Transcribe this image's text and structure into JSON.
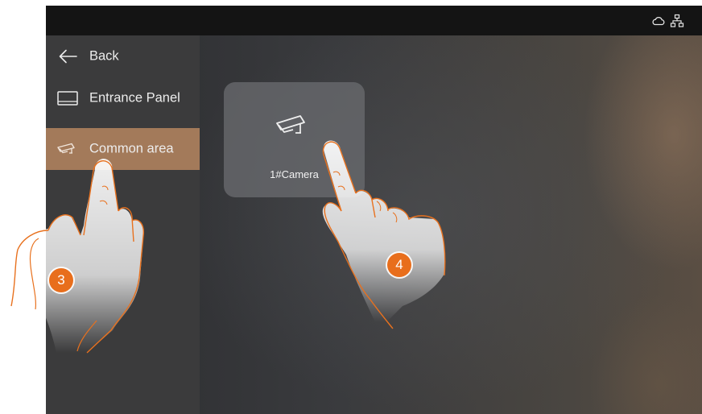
{
  "statusbar": {
    "icons": [
      "cloud-icon",
      "network-icon"
    ]
  },
  "sidebar": {
    "items": [
      {
        "label": "Back",
        "icon": "back-arrow-icon",
        "active": false
      },
      {
        "label": "Entrance Panel",
        "icon": "entrance-panel-icon",
        "active": false
      },
      {
        "label": "Common area",
        "icon": "camera-icon",
        "active": true
      }
    ]
  },
  "main": {
    "tiles": [
      {
        "label": "1#Camera",
        "icon": "cctv-camera-icon"
      }
    ]
  },
  "annotations": {
    "step_3": "3",
    "step_4": "4"
  },
  "colors": {
    "active_item": "#a37a5a",
    "badge": "#e86e1c",
    "sidebar": "#3b3b3c",
    "statusbar": "#141414",
    "hand_outline": "#e8711e"
  }
}
